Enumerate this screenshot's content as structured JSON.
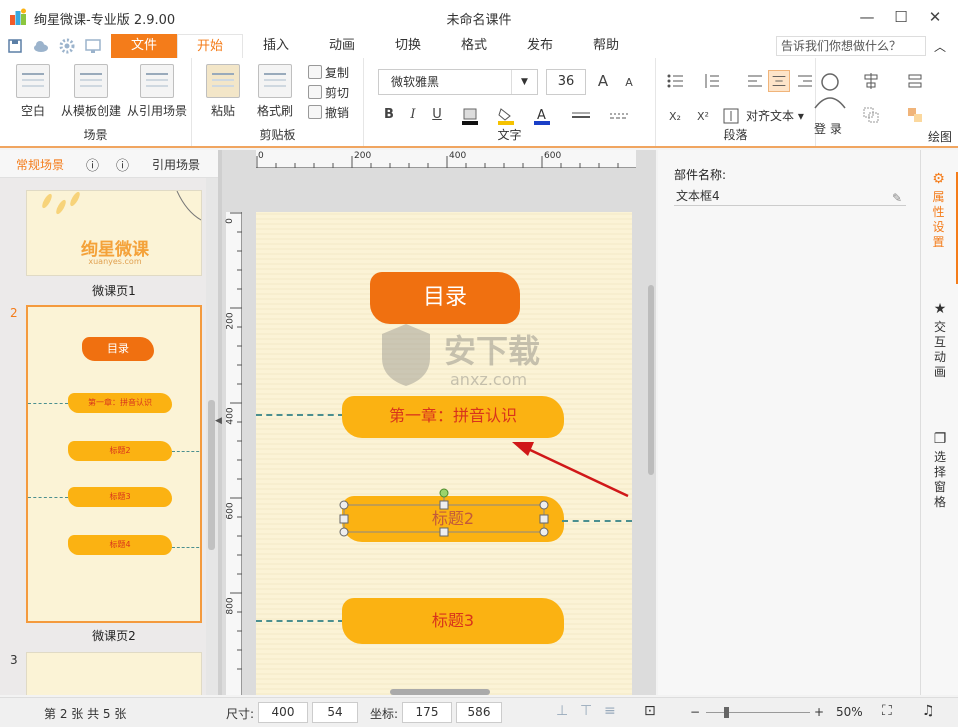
{
  "app": {
    "title": "绚星微课-专业版 2.9.00",
    "doc_title": "未命名课件"
  },
  "window_controls": {
    "minimize": "—",
    "maximize": "☐",
    "close": "✕"
  },
  "tabs": [
    "文件",
    "开始",
    "插入",
    "动画",
    "切换",
    "格式",
    "发布",
    "帮助"
  ],
  "help_placeholder": "告诉我们你想做什么？",
  "ribbon": {
    "scene": {
      "label": "场景",
      "blank": "空白",
      "from_template": "从模板创建",
      "from_ref": "从引用场景"
    },
    "clipboard": {
      "label": "剪贴板",
      "paste": "粘贴",
      "format_painter": "格式刷",
      "copy": "复制",
      "cut": "剪切",
      "undo": "撤销"
    },
    "text": {
      "label": "文字",
      "font": "微软雅黑",
      "size": "36",
      "bold": "B",
      "italic": "I",
      "underline": "U",
      "grow": "A",
      "shrink": "A"
    },
    "paragraph": {
      "label": "段落",
      "align_text": "对齐文本"
    },
    "login": "登 录",
    "draw": {
      "label": "绘图"
    }
  },
  "left_panel": {
    "tab_normal": "常规场景",
    "tab_ref": "引用场景",
    "slides": [
      {
        "num": "",
        "label": "微课页1",
        "brand": "绚星微课",
        "brand_sub": "xuanyes.com"
      },
      {
        "num": "2",
        "label": "微课页2",
        "title": "目录",
        "items": [
          "第一章：拼音认识",
          "标题2",
          "标题3",
          "标题4"
        ]
      },
      {
        "num": "3",
        "label": ""
      }
    ]
  },
  "canvas": {
    "ruler_h": [
      "0",
      "200",
      "400",
      "600"
    ],
    "ruler_v": [
      "0",
      "200",
      "400",
      "600",
      "800"
    ],
    "title": "目录",
    "item1": "第一章：拼音认识",
    "item2": "标题2",
    "item3": "标题3",
    "watermark": "安下载",
    "watermark_sub": "anxz.com"
  },
  "props": {
    "name_label": "部件名称:",
    "name_value": "文本框4"
  },
  "right_bar": {
    "props": "属性设置",
    "interaction": "交互动画",
    "select": "选择窗格"
  },
  "status": {
    "page": "第 2 张  共 5 张",
    "size_label": "尺寸:",
    "w": "400",
    "h": "54",
    "coord_label": "坐标:",
    "x": "175",
    "y": "586",
    "zoom": "50%"
  },
  "colors": {
    "accent": "#f47c1a",
    "orange_brush": "#f07010",
    "yellow_brush": "#fbb212",
    "text_red": "#d8331c"
  }
}
